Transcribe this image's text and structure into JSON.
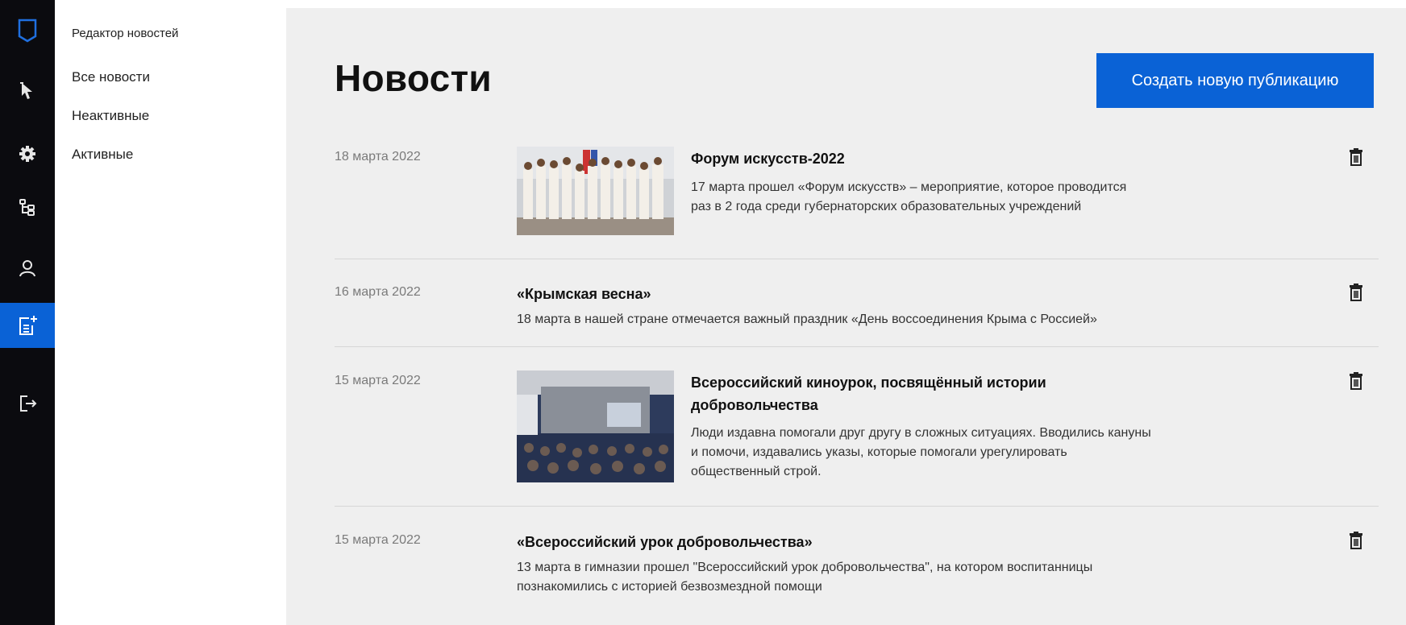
{
  "sidebar": {
    "title": "Редактор новостей",
    "links": [
      "Все новости",
      "Неактивные",
      "Активные"
    ]
  },
  "rail": {
    "icons": [
      "logo-icon",
      "cursor-icon",
      "settings-gear-icon",
      "structure-tree-icon",
      "user-icon",
      "create-news-icon",
      "logout-icon"
    ],
    "active": "create-news-icon",
    "accent": "#0a62d6"
  },
  "main": {
    "title": "Новости",
    "create_button": "Создать новую публикацию"
  },
  "news": [
    {
      "date": "18 марта 2022",
      "title": "Форум искусств-2022",
      "description": "17 марта прошел «Форум искусств» – мероприятие, которое проводится раз в 2 года среди губернаторских образовательных учреждений",
      "has_image": true
    },
    {
      "date": "16 марта 2022",
      "title": "«Крымская весна»",
      "description": "18 марта в нашей стране отмечается важный праздник «День воссоединения Крыма с Россией»",
      "has_image": false
    },
    {
      "date": "15 марта 2022",
      "title": "Всероссийский киноурок, посвящённый истории добровольчества",
      "description": "Люди издавна помогали друг другу в сложных ситуациях. Вводились кануны и помочи, издавались указы, которые помогали урегулировать общественный строй.",
      "has_image": true
    },
    {
      "date": "15 марта 2022",
      "title": "«Всероссийский урок добровольчества»",
      "description": "13 марта в гимназии прошел \"Всероссийский урок добровольчества\", на котором воспитанницы познакомились с историей безвозмездной помощи",
      "has_image": false
    }
  ]
}
